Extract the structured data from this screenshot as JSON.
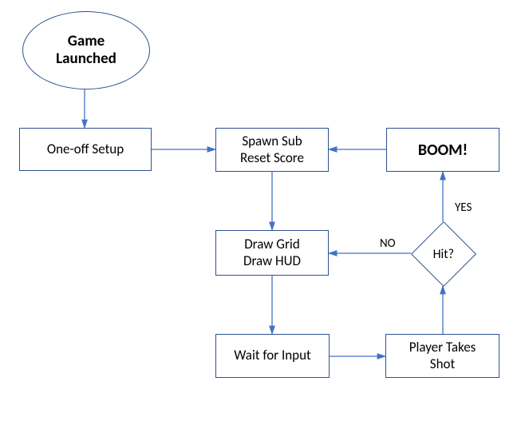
{
  "nodes": {
    "start": "Game\nLaunched",
    "setup": "One-off Setup",
    "spawn_line1": "Spawn Sub",
    "spawn_line2": "Reset Score",
    "boom": "BOOM!",
    "draw_line1": "Draw Grid",
    "draw_line2": "Draw HUD",
    "wait": "Wait for Input",
    "shot_line1": "Player Takes",
    "shot_line2": "Shot",
    "hit": "Hit?"
  },
  "labels": {
    "yes": "YES",
    "no": "NO"
  }
}
